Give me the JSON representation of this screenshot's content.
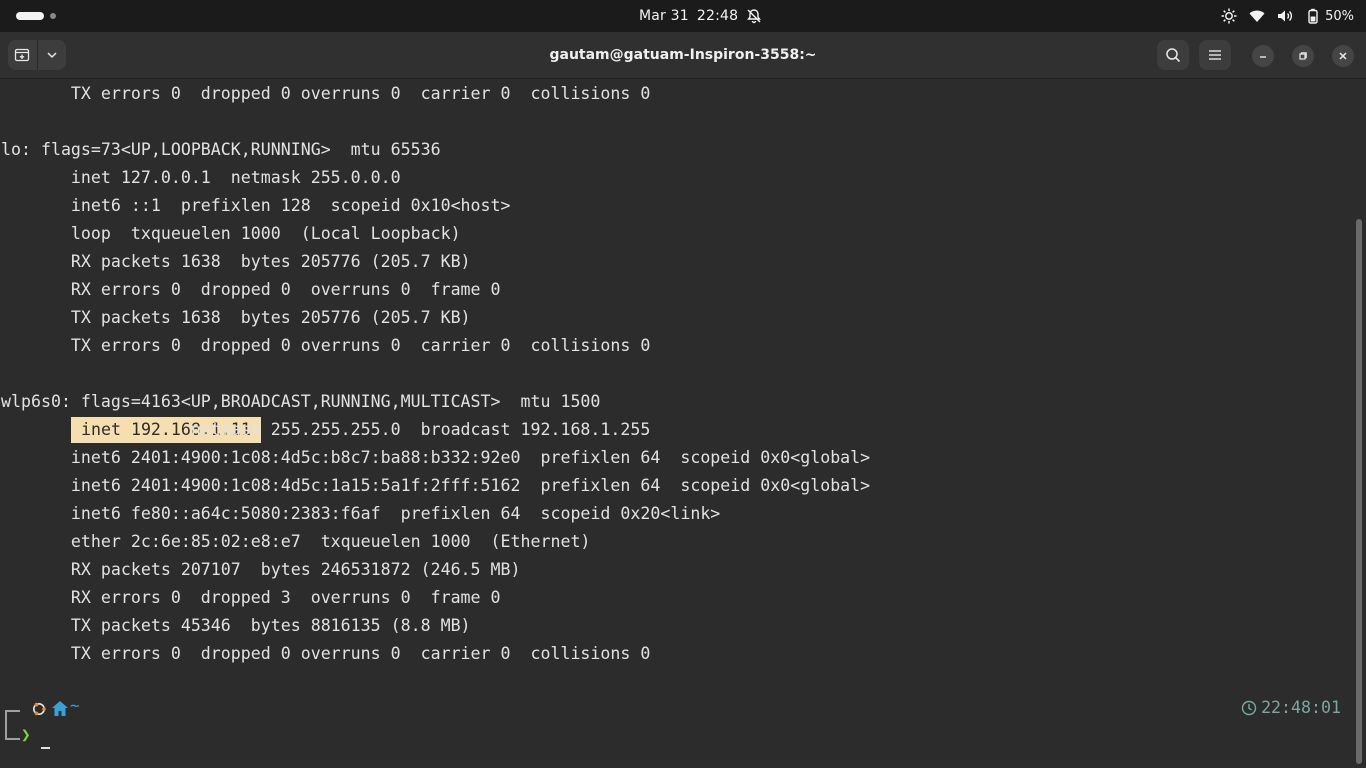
{
  "system_bar": {
    "date": "Mar 31",
    "time": "22:48",
    "battery_percent": "50%",
    "icons": [
      "workspace-indicator",
      "notifications-muted-icon",
      "brightness-icon",
      "wifi-icon",
      "volume-icon",
      "battery-icon"
    ]
  },
  "window": {
    "title": "gautam@gatuam-Inspiron-3558:~",
    "buttons": [
      "new-tab-icon",
      "dropdown-chevron-icon",
      "search-icon",
      "hamburger-menu-icon",
      "minimize-icon",
      "maximize-icon",
      "close-icon"
    ]
  },
  "terminal": {
    "lines": [
      "       TX errors 0  dropped 0 overruns 0  carrier 0  collisions 0",
      "",
      "lo: flags=73<UP,LOOPBACK,RUNNING>  mtu 65536",
      "       inet 127.0.0.1  netmask 255.0.0.0",
      "       inet6 ::1  prefixlen 128  scopeid 0x10<host>",
      "       loop  txqueuelen 1000  (Local Loopback)",
      "       RX packets 1638  bytes 205776 (205.7 KB)",
      "       RX errors 0  dropped 0  overruns 0  frame 0",
      "       TX packets 1638  bytes 205776 (205.7 KB)",
      "       TX errors 0  dropped 0 overruns 0  carrier 0  collisions 0",
      "",
      "wlp6s0: flags=4163<UP,BROADCAST,RUNNING,MULTICAST>  mtu 1500",
      "                   netmask 255.255.255.0  broadcast 192.168.1.255",
      "       inet6 2401:4900:1c08:4d5c:b8c7:ba88:b332:92e0  prefixlen 64  scopeid 0x0<global>",
      "       inet6 2401:4900:1c08:4d5c:1a15:5a1f:2fff:5162  prefixlen 64  scopeid 0x0<global>",
      "       inet6 fe80::a64c:5080:2383:f6af  prefixlen 64  scopeid 0x20<link>",
      "       ether 2c:6e:85:02:e8:e7  txqueuelen 1000  (Ethernet)",
      "       RX packets 207107  bytes 246531872 (246.5 MB)",
      "       RX errors 0  dropped 3  overruns 0  frame 0",
      "       TX packets 45346  bytes 8816135 (8.8 MB)",
      "       TX errors 0  dropped 0 overruns 0  carrier 0  collisions 0"
    ],
    "highlighted_text": "inet 192.168.1.11",
    "prompt": {
      "dir": "~",
      "arrow": "❯",
      "right_time": "22:48:01"
    }
  }
}
